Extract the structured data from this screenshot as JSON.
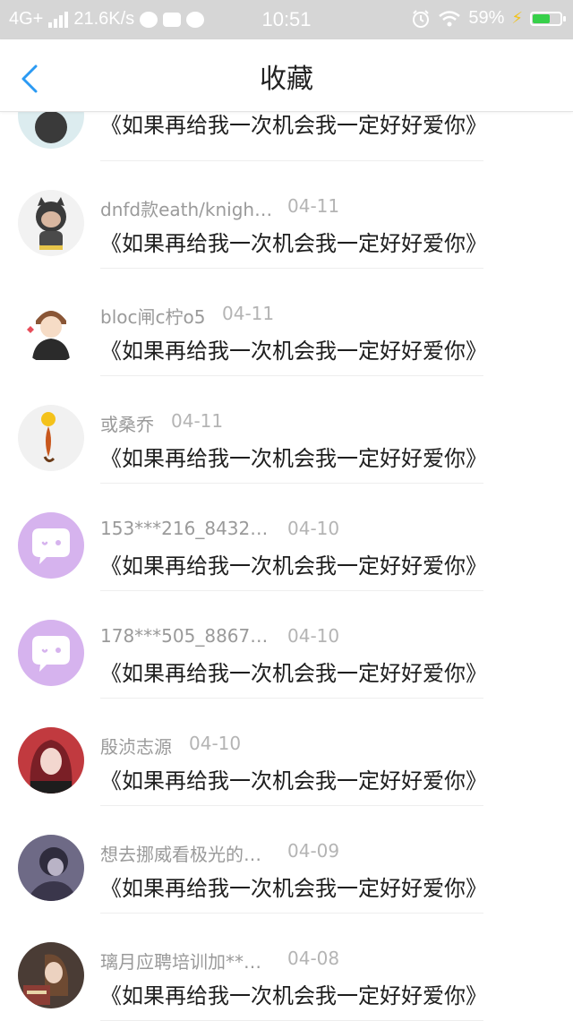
{
  "status_bar": {
    "network": "4G+",
    "speed": "21.6K/s",
    "time": "10:51",
    "battery": "59%",
    "battery_level": 0.59
  },
  "header": {
    "title": "收藏",
    "back_icon": "chevron-left-icon"
  },
  "colors": {
    "accent": "#2b9af3",
    "status_bar": "#d6d6d6",
    "chat_avatar": "#d6b3ee",
    "battery": "#37d04a"
  },
  "items": [
    {
      "name": "",
      "date": "",
      "text": "《如果再给我一次机会我一定好好爱你》",
      "avatar": "avatar-image"
    },
    {
      "name": "dnfd款eath/knigh…",
      "date": "04-11",
      "text": "《如果再给我一次机会我一定好好爱你》",
      "avatar": "avatar-image"
    },
    {
      "name": "bloc闸c柠o5",
      "date": "04-11",
      "text": "《如果再给我一次机会我一定好好爱你》",
      "avatar": "avatar-image"
    },
    {
      "name": "或桑乔",
      "date": "04-11",
      "text": "《如果再给我一次机会我一定好好爱你》",
      "avatar": "avatar-image"
    },
    {
      "name": "153***216_8432…",
      "date": "04-10",
      "text": "《如果再给我一次机会我一定好好爱你》",
      "avatar": "chat-bubble-icon"
    },
    {
      "name": "178***505_8867…",
      "date": "04-10",
      "text": "《如果再给我一次机会我一定好好爱你》",
      "avatar": "chat-bubble-icon"
    },
    {
      "name": "殷浈志源",
      "date": "04-10",
      "text": "《如果再给我一次机会我一定好好爱你》",
      "avatar": "avatar-image"
    },
    {
      "name": "想去挪威看极光的…",
      "date": "04-09",
      "text": "《如果再给我一次机会我一定好好爱你》",
      "avatar": "avatar-image"
    },
    {
      "name": "璃月应聘培训加**…",
      "date": "04-08",
      "text": "《如果再给我一次机会我一定好好爱你》",
      "avatar": "avatar-image"
    }
  ]
}
